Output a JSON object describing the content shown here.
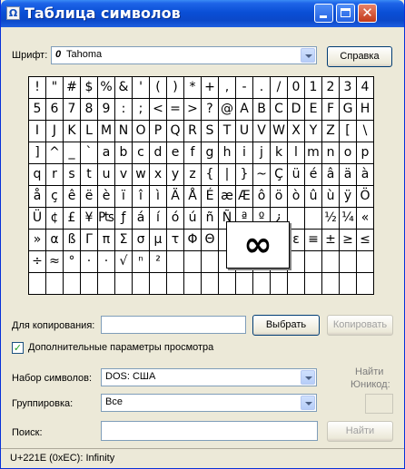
{
  "window": {
    "title": "Таблица символов",
    "icon_glyph": "Ω"
  },
  "font_row": {
    "label": "Шрифт:",
    "font_glyph": "0",
    "font_value": "Tahoma",
    "help_button": "Справка"
  },
  "characters": [
    "!",
    "\"",
    "#",
    "$",
    "%",
    "&",
    "'",
    "(",
    ")",
    "*",
    "+",
    ",",
    "-",
    ".",
    "/",
    "0",
    "1",
    "2",
    "3",
    "4",
    "5",
    "6",
    "7",
    "8",
    "9",
    ":",
    ";",
    "<",
    "=",
    ">",
    "?",
    "@",
    "A",
    "B",
    "C",
    "D",
    "E",
    "F",
    "G",
    "H",
    "I",
    "J",
    "K",
    "L",
    "M",
    "N",
    "O",
    "P",
    "Q",
    "R",
    "S",
    "T",
    "U",
    "V",
    "W",
    "X",
    "Y",
    "Z",
    "[",
    "\\",
    "]",
    "^",
    "_",
    "`",
    "a",
    "b",
    "c",
    "d",
    "e",
    "f",
    "g",
    "h",
    "i",
    "j",
    "k",
    "l",
    "m",
    "n",
    "o",
    "p",
    "q",
    "r",
    "s",
    "t",
    "u",
    "v",
    "w",
    "x",
    "y",
    "z",
    "{",
    "|",
    "}",
    "~",
    "Ç",
    "ü",
    "é",
    "â",
    "ä",
    "à",
    "å",
    "ç",
    "ê",
    "ë",
    "è",
    "ï",
    "î",
    "ì",
    "Ä",
    "Å",
    "É",
    "æ",
    "Æ",
    "ô",
    "ö",
    "ò",
    "û",
    "ù",
    "ÿ",
    "Ö",
    "Ü",
    "¢",
    "£",
    "¥",
    "₧",
    "ƒ",
    "á",
    "í",
    "ó",
    "ú",
    "ñ",
    "Ñ",
    "ª",
    "º",
    "¿",
    "",
    "",
    "½",
    "¼",
    "«",
    "»",
    "α",
    "ß",
    "Γ",
    "π",
    "Σ",
    "σ",
    "µ",
    "τ",
    "Φ",
    "Θ",
    "",
    "",
    "",
    "",
    "ε",
    "≡",
    "±",
    "≥",
    "≤",
    "÷",
    "≈",
    "°",
    "·",
    "·",
    "√",
    "ⁿ",
    "²",
    "",
    "",
    "",
    "",
    "",
    "",
    "",
    "",
    "",
    "",
    "",
    "",
    "",
    "",
    "",
    "",
    "",
    "",
    "",
    "",
    "",
    "",
    "",
    "",
    "",
    "",
    "",
    "",
    "",
    "",
    "",
    ""
  ],
  "preview": {
    "char": "∞"
  },
  "copy_row": {
    "label": "Для копирования:",
    "value": "",
    "select_button": "Выбрать",
    "copy_button": "Копировать"
  },
  "advanced": {
    "checked": true,
    "check_glyph": "✓",
    "label": "Дополнительные параметры просмотра"
  },
  "charset": {
    "label": "Набор символов:",
    "value": "DOS: США"
  },
  "unicode_lookup": {
    "label_line1": "Найти",
    "label_line2": "Юникод:"
  },
  "grouping": {
    "label": "Группировка:",
    "value": "Все"
  },
  "search": {
    "label": "Поиск:",
    "value": "",
    "button": "Найти"
  },
  "status": {
    "text": "U+221E (0xEC): Infinity"
  }
}
